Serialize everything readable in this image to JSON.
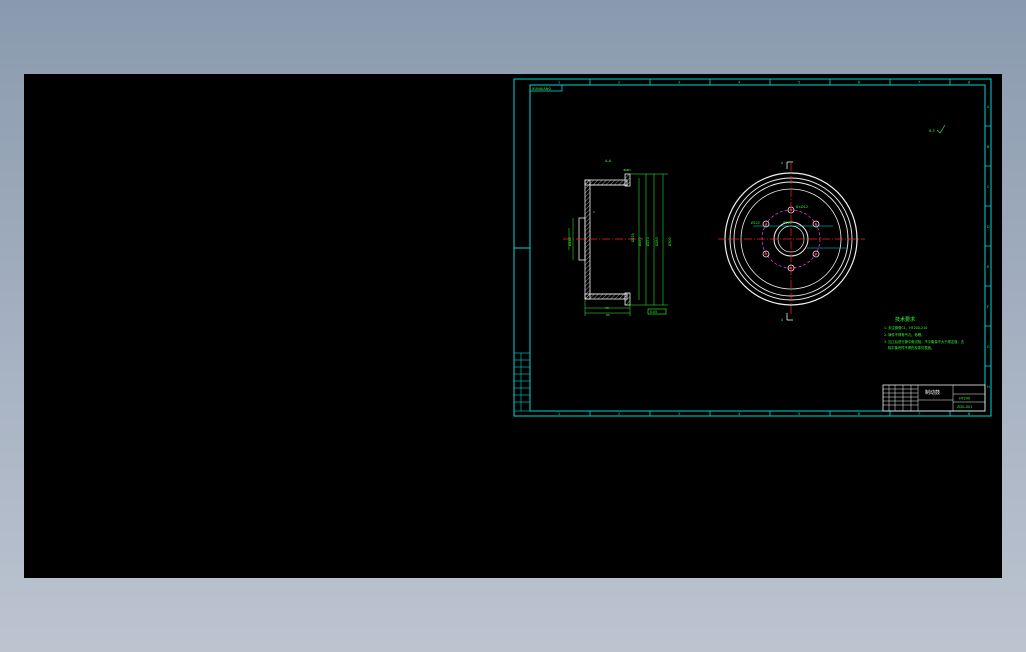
{
  "viewport": {
    "background": "#000000"
  },
  "drawing": {
    "frame_color": "#00d6d6",
    "part_color": "#f0f0f0",
    "dim_color": "#33ff33",
    "center_color": "#ff2020",
    "hidden_color": "#ff33ff",
    "frame_label": "XUNXIANG",
    "top_columns": [
      "1",
      "2",
      "3",
      "4",
      "5",
      "6",
      "7",
      "8"
    ],
    "bottom_columns": [
      "1",
      "2",
      "3",
      "4",
      "5",
      "6",
      "7",
      "8"
    ],
    "right_rows": [
      "A",
      "B",
      "C",
      "D",
      "E",
      "F",
      "G",
      "H"
    ],
    "section_label": "A-A",
    "roughness": "6.3",
    "dim_bore": "Ø140",
    "dim_hole": "6×Ø12",
    "tech_req": {
      "title": "技术要求",
      "lines": [
        "1. 未注倒角C1，HT200-210",
        "2. 铸件不得有气孔、砂眼。",
        "3. 加工后进行静平衡试验，不平衡量不大于规定值，去",
        "除平衡块时不得伤及零件表面。"
      ]
    },
    "title_block": {
      "part_name": "制动鼓",
      "material": "HT200",
      "drawing_no": "ZDG-001"
    }
  }
}
